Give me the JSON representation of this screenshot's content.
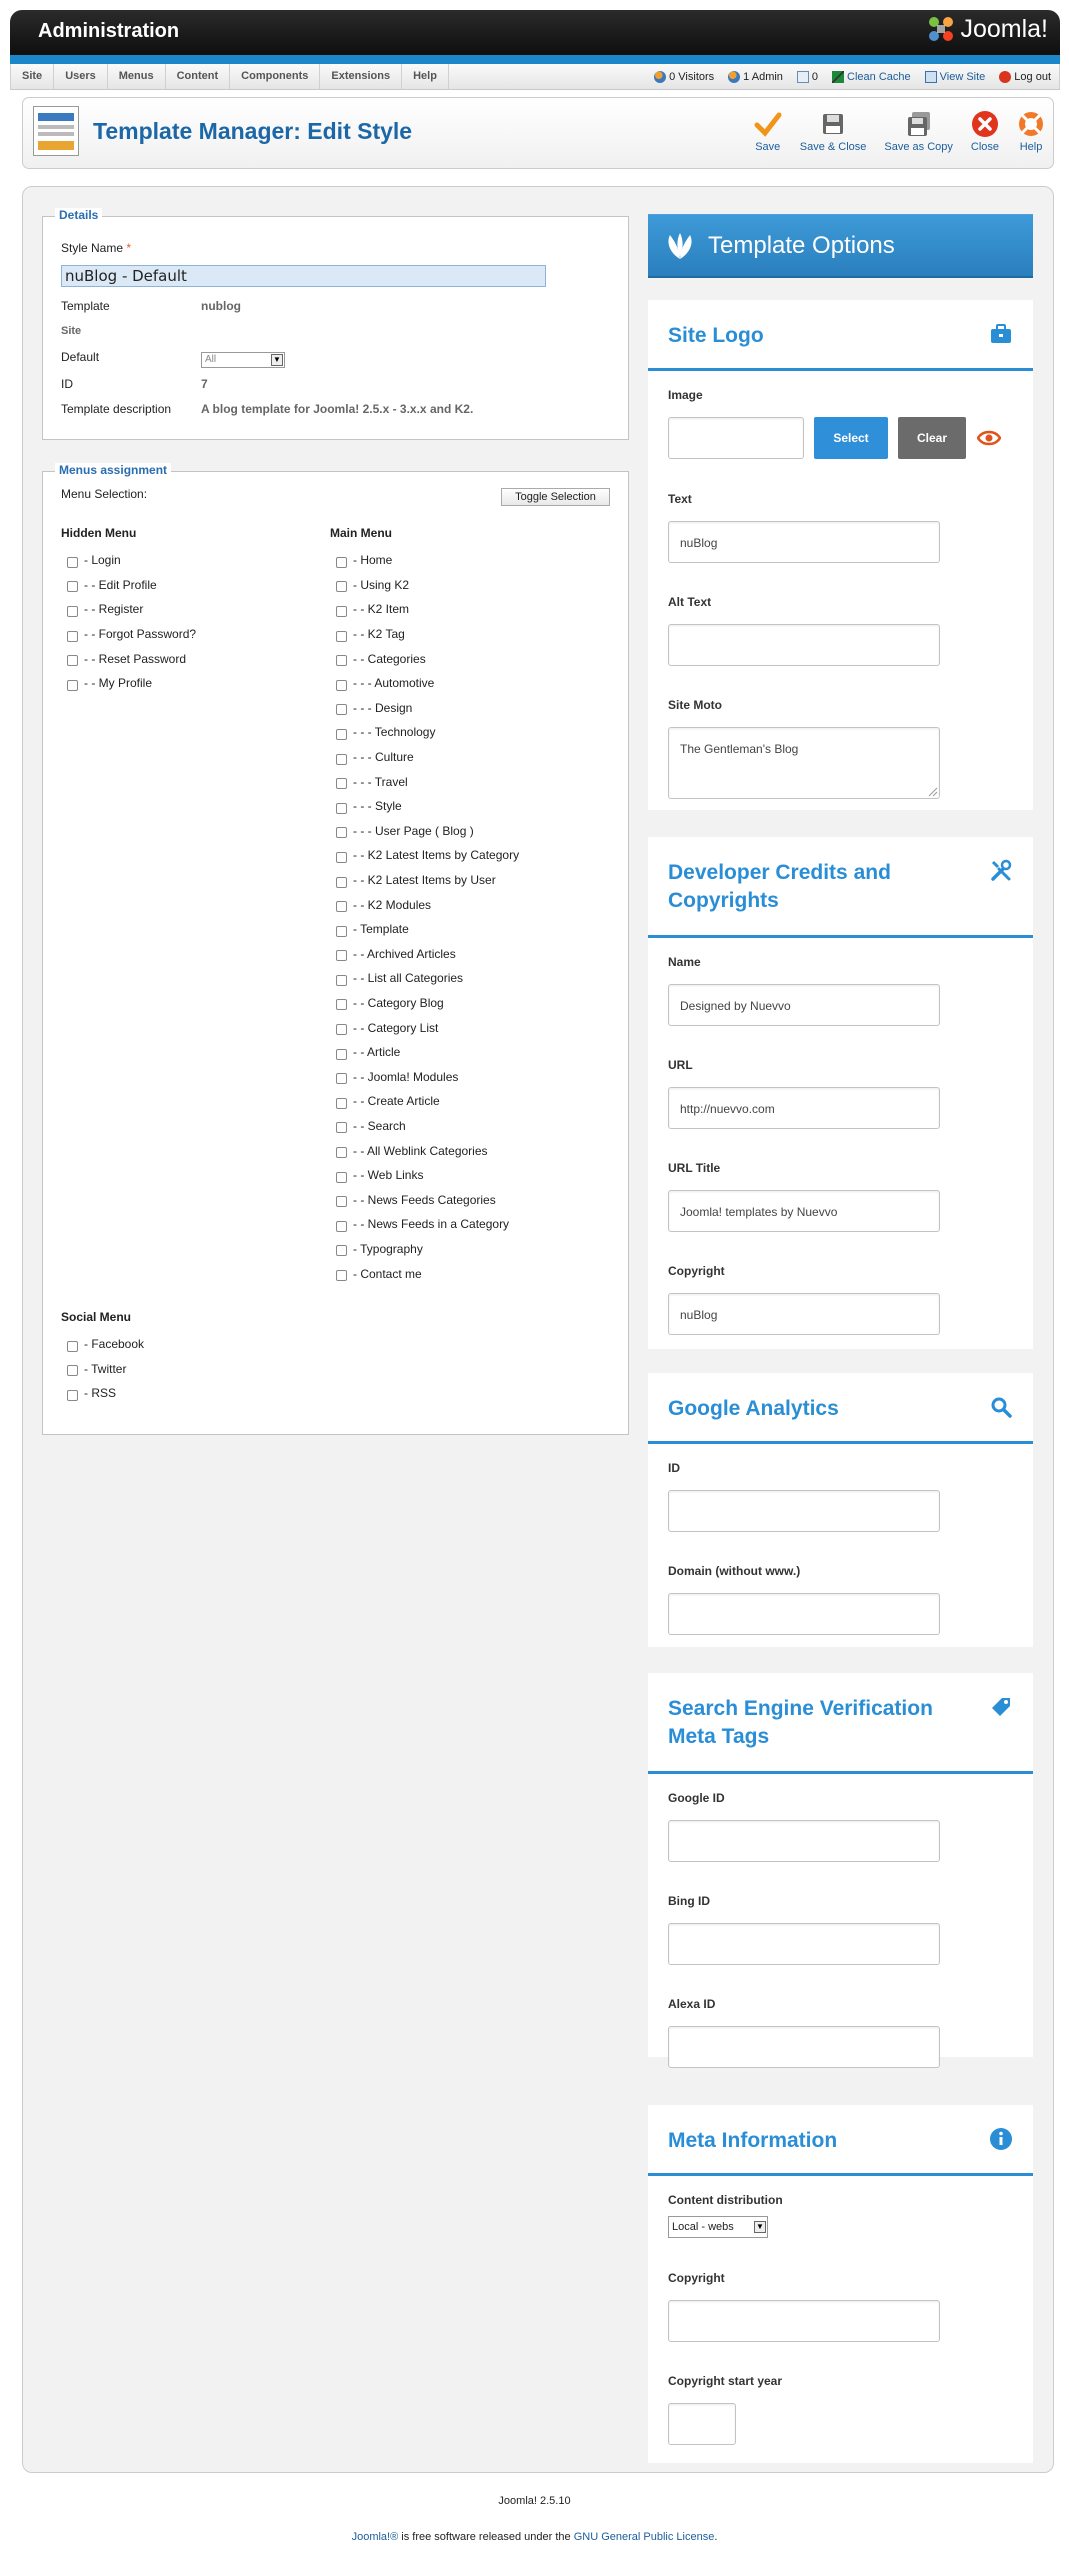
{
  "header": {
    "title": "Administration",
    "brand": "Joomla!"
  },
  "menu": {
    "items": [
      "Site",
      "Users",
      "Menus",
      "Content",
      "Components",
      "Extensions",
      "Help"
    ]
  },
  "status": {
    "visitors": "0 Visitors",
    "admins": "1 Admin",
    "messages": "0",
    "clean_cache": "Clean Cache",
    "view_site": "View Site",
    "logout": "Log out"
  },
  "toolbar": {
    "title": "Template Manager: Edit Style",
    "buttons": {
      "save": "Save",
      "save_close": "Save & Close",
      "save_copy": "Save as Copy",
      "close": "Close",
      "help": "Help"
    }
  },
  "details": {
    "legend": "Details",
    "style_name_label": "Style Name",
    "required_mark": "*",
    "style_name_value": "nuBlog - Default",
    "template_label": "Template",
    "template_value": "nublog",
    "site_label": "Site",
    "default_label": "Default",
    "default_value": "All",
    "id_label": "ID",
    "id_value": "7",
    "desc_label": "Template description",
    "desc_value": "A blog template for Joomla! 2.5.x - 3.x.x and K2."
  },
  "menus": {
    "legend": "Menus assignment",
    "selection_label": "Menu Selection:",
    "toggle": "Toggle Selection",
    "hidden_title": "Hidden Menu",
    "hidden_items": [
      "- Login",
      "- - Edit Profile",
      "- - Register",
      "- - Forgot Password?",
      "- - Reset Password",
      "- - My Profile"
    ],
    "main_title": "Main Menu",
    "main_items": [
      "- Home",
      "- Using K2",
      "- - K2 Item",
      "- - K2 Tag",
      "- - Categories",
      "- - - Automotive",
      "- - - Design",
      "- - - Technology",
      "- - - Culture",
      "- - - Travel",
      "- - - Style",
      "- - - User Page ( Blog )",
      "- - K2 Latest Items by Category",
      "- - K2 Latest Items by User",
      "- - K2 Modules",
      "- Template",
      "- - Archived Articles",
      "- - List all Categories",
      "- - Category Blog",
      "- - Category List",
      "- - Article",
      "- - Joomla! Modules",
      "- - Create Article",
      "- - Search",
      "- - All Weblink Categories",
      "- - Web Links",
      "- - News Feeds Categories",
      "- - News Feeds in a Category",
      "- Typography",
      "- Contact me"
    ],
    "social_title": "Social Menu",
    "social_items": [
      "- Facebook",
      "- Twitter",
      "- RSS"
    ]
  },
  "options": {
    "title": "Template Options",
    "site_logo": {
      "title": "Site Logo",
      "image_label": "Image",
      "select": "Select",
      "clear": "Clear",
      "text_label": "Text",
      "text_value": "nuBlog",
      "alt_label": "Alt Text",
      "alt_value": "",
      "moto_label": "Site Moto",
      "moto_value": "The Gentleman's Blog"
    },
    "credits": {
      "title": "Developer Credits and Copyrights",
      "name_label": "Name",
      "name_value": "Designed by Nuevvo",
      "url_label": "URL",
      "url_value": "http://nuevvo.com",
      "url_title_label": "URL Title",
      "url_title_value": "Joomla! templates by Nuevvo",
      "copyright_label": "Copyright",
      "copyright_value": "nuBlog"
    },
    "analytics": {
      "title": "Google Analytics",
      "id_label": "ID",
      "id_value": "",
      "domain_label": "Domain (without www.)",
      "domain_value": ""
    },
    "verification": {
      "title": "Search Engine Verification Meta Tags",
      "google_label": "Google ID",
      "google_value": "",
      "bing_label": "Bing ID",
      "bing_value": "",
      "alexa_label": "Alexa ID",
      "alexa_value": ""
    },
    "meta": {
      "title": "Meta Information",
      "distribution_label": "Content distribution",
      "distribution_value": "Local - webs",
      "copyright_label": "Copyright",
      "copyright_value": "",
      "year_label": "Copyright start year",
      "year_value": ""
    }
  },
  "footer": {
    "version": "Joomla! 2.5.10",
    "brand_link": "Joomla!®",
    "text_mid": " is free software released under the ",
    "license_link": "GNU General Public License",
    "text_end": "."
  },
  "colors": {
    "accent": "#2a8ed6",
    "header": "#1b1b1b",
    "title": "#1c67a7"
  }
}
